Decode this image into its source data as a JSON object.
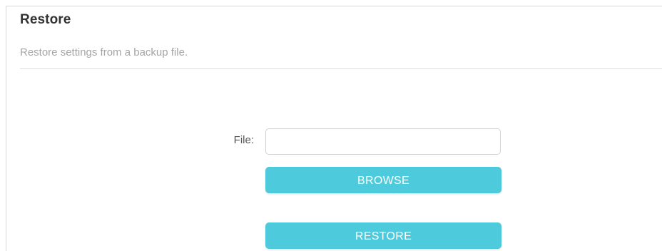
{
  "restore_section": {
    "title": "Restore",
    "description": "Restore settings from a backup file.",
    "file_label": "File:",
    "file_value": "",
    "browse_label": "BROWSE",
    "restore_label": "RESTORE"
  },
  "colors": {
    "button_bg": "#4dcbdd",
    "button_text": "#ffffff",
    "title_text": "#333333",
    "description_text": "#a5a5a5"
  }
}
